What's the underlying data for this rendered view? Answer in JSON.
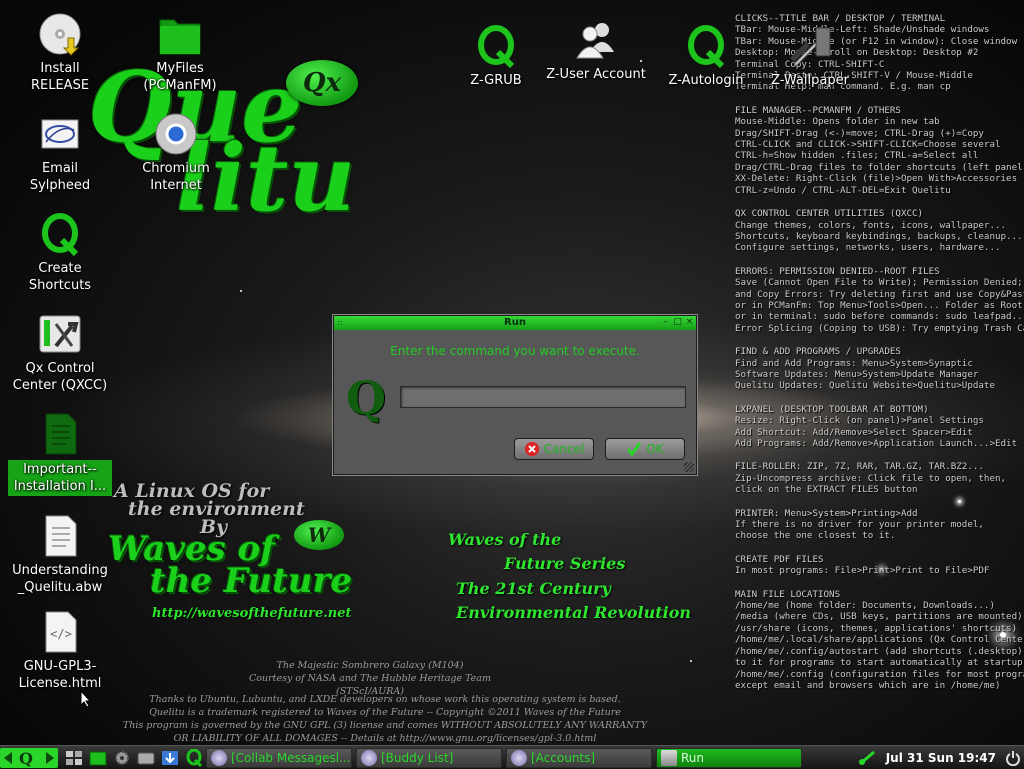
{
  "desktop": {
    "icons": [
      {
        "id": "install",
        "label": "Install\nRELEASE"
      },
      {
        "id": "myfiles",
        "label": "MyFiles\n(PCManFM)"
      },
      {
        "id": "zgrub",
        "label": "Z-GRUB"
      },
      {
        "id": "zuser",
        "label": "Z-User Account"
      },
      {
        "id": "zautologin",
        "label": "Z-Autologin"
      },
      {
        "id": "zwallpaper",
        "label": "Z-Wallpaper"
      },
      {
        "id": "email",
        "label": "Email\nSylpheed"
      },
      {
        "id": "chromium",
        "label": "Chromium\nInternet"
      },
      {
        "id": "shortcuts",
        "label": "Create\nShortcuts"
      },
      {
        "id": "qxcc",
        "label": "Qx Control\nCenter (QXCC)"
      },
      {
        "id": "important",
        "label": "Important--\nInstallation I..."
      },
      {
        "id": "understanding",
        "label": "Understanding\n_Quelitu.abw"
      },
      {
        "id": "gpl",
        "label": "GNU-GPL3-\nLicense.html"
      }
    ]
  },
  "wallpaper": {
    "logo_line1": "Que",
    "logo_line2": "litu",
    "qx_badge": "Qx",
    "slogan1": "A Linux OS for",
    "slogan2": "the environment",
    "slogan3": "By",
    "wotf1": "Waves of",
    "wotf2": "the Future",
    "w_badge": "W",
    "url": "http://wavesofthefuture.net",
    "series1": "Waves of the",
    "series2": "Future Series",
    "series3": "The 21st Century",
    "series4": "Environmental Revolution",
    "galaxy1": "The Majestic Sombrero Galaxy (M104)",
    "galaxy2": "Courtesy of NASA and The Hubble Heritage Team (STScI/AURA)",
    "legal1": "Thanks to Ubuntu, Lubuntu, and LXDE developers on whose work this operating system is based.",
    "legal2": "Quelitu is a trademark registered to Waves of the Future  --  Copyright ©2011 Waves of the Future",
    "legal3": "This program is governed by the GNU GPL (3) license and comes WITHOUT ABSOLUTELY ANY WARRANTY",
    "legal4": "OR LIABILITY OF ALL DOMAGES -- Details at http://www.gnu.org/licenses/gpl-3.0.html"
  },
  "help": [
    {
      "title": "CLICKS--TITLE BAR / DESKTOP / TERMINAL",
      "lines": [
        "TBar: Mouse-Middle-Left: Shade/Unshade windows",
        "TBar: Mouse-Middle (or F12 in window): Close window",
        "Desktop: Mouse-Scroll on Desktop: Desktop #2",
        "Terminal Copy: CTRL-SHIFT-C",
        "Terminal Paste: CTRL-SHIFT-V / Mouse-Middle",
        "Terminal Help: man command. E.g. man cp"
      ]
    },
    {
      "title": "FILE MANAGER--PCMANFM / OTHERS",
      "lines": [
        "Mouse-Middle: Opens folder in new tab",
        "Drag/SHIFT-Drag (<-)=move; CTRL-Drag (+)=Copy",
        "CTRL-CLICK and CLICK->SHIFT-CLICK=Choose several",
        "CTRL-h=Show hidden .files; CTRL-a=Select all",
        "Drag/CTRL-Drag files to folder shortcuts (left panel)=Yes",
        "XX-Delete: Right-Click (file)>Open With>Accessories",
        "CTRL-z=Undo / CTRL-ALT-DEL=Exit Quelitu"
      ]
    },
    {
      "title": "QX CONTROL CENTER UTILITIES (QXCC)",
      "lines": [
        "Change themes, colors, fonts, icons, wallpaper...",
        "Shortcuts, keyboard keybindings, backups, cleanup...",
        "Configure settings, networks, users, hardware..."
      ]
    },
    {
      "title": "ERRORS: PERMISSION DENIED--ROOT FILES",
      "lines": [
        "Save (Cannot Open File to Write); Permission Denied;",
        "and Copy Errors: Try deleting first and use Copy&Paste,",
        "or in PCManFm: Top Menu>Tools>Open... Folder as Root",
        "or in terminal: sudo before commands: sudo leafpad...",
        "Error Splicing (Coping to USB): Try emptying Trash Can"
      ]
    },
    {
      "title": "FIND & ADD PROGRAMS / UPGRADES",
      "lines": [
        "Find and Add Programs: Menu>System>Synaptic",
        "Software Updates: Menu>System>Update Manager",
        "Quelitu Updates: Quelitu Website>Quelitu>Update"
      ]
    },
    {
      "title": "LXPANEL (DESKTOP TOOLBAR AT BOTTOM)",
      "lines": [
        "Resize: Right-Click (on panel)>Panel Settings",
        "Add Shortcut: Add/Remove>Select Spacer>Edit",
        "Add Programs: Add/Remove>Application Launch...>Edit"
      ]
    },
    {
      "title": "FILE-ROLLER: ZIP, 7Z, RAR, TAR.GZ, TAR.BZ2...",
      "lines": [
        "Zip-Uncompress archive: Click file to open, then,",
        "click on the EXTRACT FILES button"
      ]
    },
    {
      "title": "PRINTER: Menu>System>Printing>Add",
      "lines": [
        "If there is no driver for your printer model,",
        "choose the one closest to it."
      ]
    },
    {
      "title": "CREATE PDF FILES",
      "lines": [
        "In most programs: File>Print>Print to File>PDF"
      ]
    },
    {
      "title": "MAIN FILE LOCATIONS",
      "lines": [
        "/home/me (home folder: Documents, Downloads...)",
        "/media (where CDs, USB keys, partitions are mounted)",
        "/usr/share (icons, themes, applications' shortcuts)",
        "/home/me/.local/share/applications (Qx Control Center)",
        "/home/me/.config/autostart (add shortcuts (.desktop)",
        "to it for programs to start automatically at startup",
        "/home/me/.config (configuration files for most programs",
        "except email and browsers which are in /home/me)"
      ]
    }
  ],
  "run_dialog": {
    "title": "Run",
    "prompt": "Enter the command you want to execute.",
    "logo": "Q",
    "command_value": "",
    "cancel_label": "Cancel",
    "cancel_mnemonic": "C",
    "ok_label": "OK",
    "ok_mnemonic": "O"
  },
  "taskbar": {
    "tasks": [
      {
        "id": "collab",
        "label": "[Collab Messagesl..."
      },
      {
        "id": "buddy",
        "label": "[Buddy List]"
      },
      {
        "id": "accounts",
        "label": "[Accounts]"
      },
      {
        "id": "run",
        "label": "Run"
      }
    ],
    "clock": "Jul 31 Sun 19:47"
  },
  "colors": {
    "accent": "#1bd01b",
    "taskbar_active": "#20b820",
    "dialog_bg": "#575757"
  },
  "icon_names": [
    "cd-install-icon",
    "folder-icon",
    "q-icon",
    "users-icon",
    "wallpaper-icon",
    "email-icon",
    "chromium-icon",
    "wrench-icon",
    "document-icon",
    "html-file-icon",
    "power-icon",
    "show-desktop-icon"
  ]
}
